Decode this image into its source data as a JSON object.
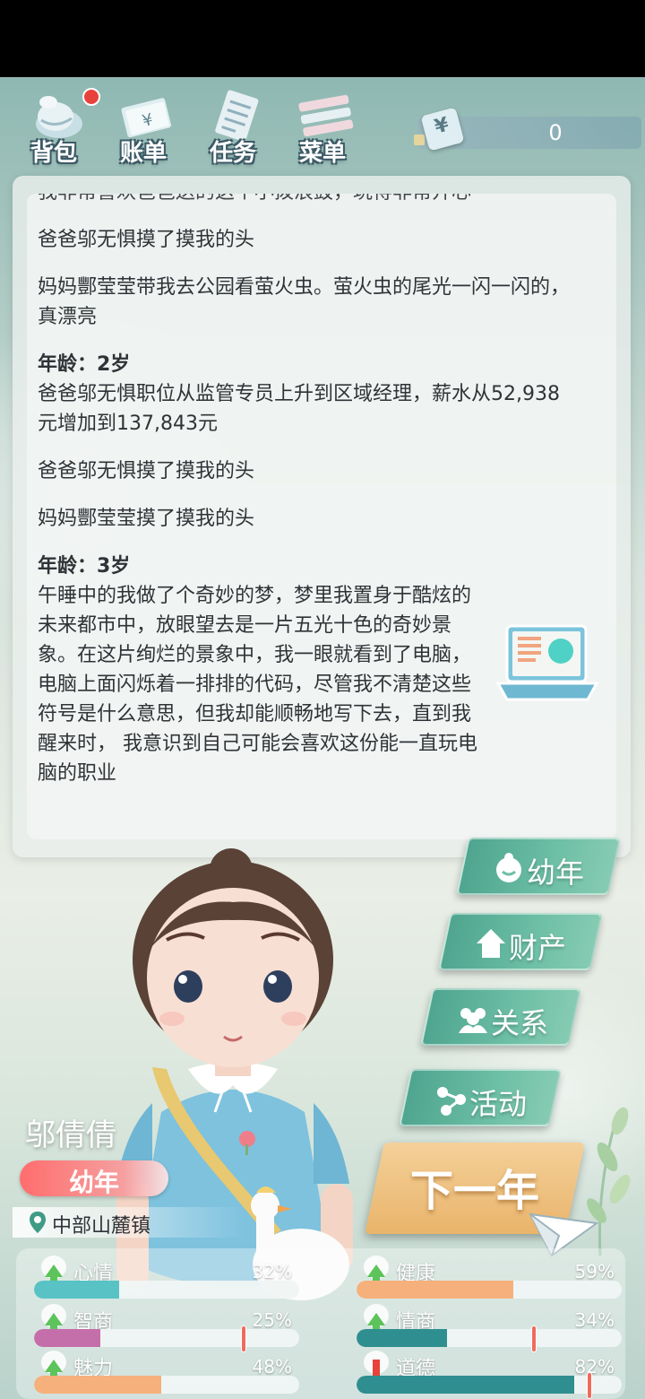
{
  "nav": {
    "items": [
      {
        "label": "背包",
        "icon": "bag-icon",
        "badge": true
      },
      {
        "label": "账单",
        "icon": "bill-icon"
      },
      {
        "label": "任务",
        "icon": "task-icon"
      },
      {
        "label": "菜单",
        "icon": "menu-icon"
      }
    ]
  },
  "money": {
    "symbol": "¥",
    "value": "0"
  },
  "log": {
    "partial_top": "我非常喜欢爸爸送的这个小拨浪鼓，玩得非常开心",
    "entries_pre": [
      "爸爸邬无惧摸了摸我的头",
      "妈妈酆莹莹带我去公园看萤火虫。萤火虫的尾光一闪一闪的，真漂亮"
    ],
    "age2_title": "年龄：2岁",
    "age2_entries": [
      "爸爸邬无惧职位从监管专员上升到区域经理，薪水从52,938元增加到137,843元",
      "爸爸邬无惧摸了摸我的头",
      "妈妈酆莹莹摸了摸我的头"
    ],
    "age3_title": "年龄：3岁",
    "age3_entry": "午睡中的我做了个奇妙的梦，梦里我置身于酷炫的未来都市中，放眼望去是一片五光十色的奇妙景象。在这片绚烂的景象中，我一眼就看到了电脑，电脑上面闪烁着一排排的代码，尽管我不清楚这些符号是什么意思，但我却能顺畅地写下去，直到我醒来时，  我意识到自己可能会喜欢这份能一直玩电脑的职业"
  },
  "stages": {
    "childhood": "幼年",
    "property": "财产",
    "relations": "关系",
    "activity": "活动",
    "next_year": "下一年"
  },
  "character": {
    "name": "邬倩倩",
    "stage": "幼年",
    "location": "中部山麓镇"
  },
  "stats": [
    {
      "label": "心情",
      "value": "32%",
      "level": 0.32,
      "trend": "up",
      "color": "#58c2c4"
    },
    {
      "label": "健康",
      "value": "59%",
      "level": 0.59,
      "trend": "up",
      "color": "#f6b07c"
    },
    {
      "label": "智商",
      "value": "25%",
      "level": 0.25,
      "trend": "up",
      "color": "#c56faa",
      "marker": 0.79
    },
    {
      "label": "情商",
      "value": "34%",
      "level": 0.34,
      "trend": "up",
      "color": "#2f8e90",
      "marker": 0.67
    },
    {
      "label": "魅力",
      "value": "48%",
      "level": 0.48,
      "trend": "up",
      "color": "#f6b07c"
    },
    {
      "label": "道德",
      "value": "82%",
      "level": 0.82,
      "trend": "down",
      "color": "#2f8e90",
      "marker": 0.88
    }
  ]
}
